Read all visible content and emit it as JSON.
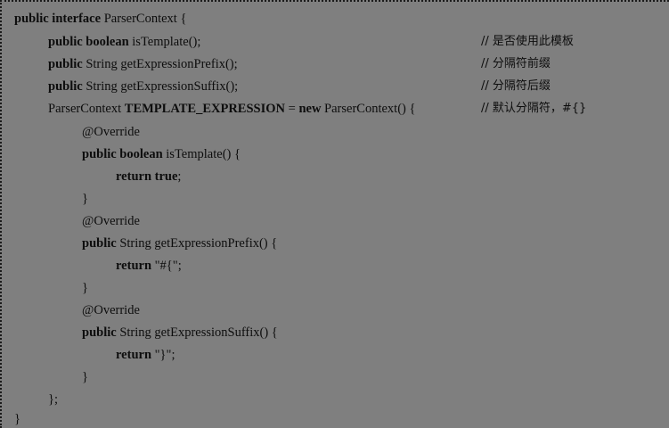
{
  "code": {
    "lines": [
      [
        "public interface",
        " ParserContext {"
      ],
      [
        "public boolean",
        " isTemplate();"
      ],
      [
        "public",
        " String getExpressionPrefix();"
      ],
      [
        "public",
        " String getExpressionSuffix();"
      ],
      [
        "ParserContext ",
        "TEMPLATE_EXPRESSION",
        " = ",
        "new",
        " ParserContext() {"
      ],
      [
        "@Override"
      ],
      [
        "public boolean",
        " isTemplate() {"
      ],
      [
        "return true",
        ";"
      ],
      [
        "}"
      ],
      [
        "@Override"
      ],
      [
        "public",
        " String getExpressionPrefix() {"
      ],
      [
        "return",
        " \"#{\";"
      ],
      [
        "}"
      ],
      [
        "@Override"
      ],
      [
        "public",
        " String getExpressionSuffix() {"
      ],
      [
        "return",
        " \"}\";"
      ],
      [
        "}"
      ],
      [
        "};"
      ],
      [
        "}"
      ]
    ],
    "comments": [
      "// 是否使用此模板",
      "// 分隔符前缀",
      "// 分隔符后缀",
      "// 默认分隔符，#{}"
    ]
  }
}
